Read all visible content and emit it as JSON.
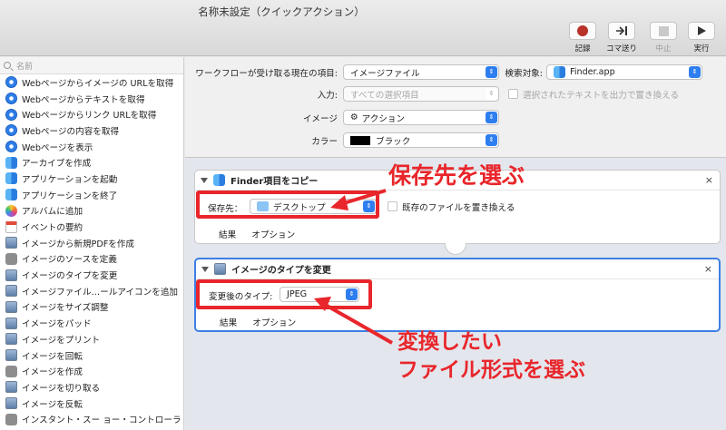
{
  "window": {
    "title": "名称未設定（クイックアクション）"
  },
  "toolbar": {
    "record": "記録",
    "step": "コマ送り",
    "stop": "中止",
    "run": "実行"
  },
  "sidebar": {
    "search_placeholder": "名前",
    "items": [
      {
        "label": "Webページからイメージの URLを取得",
        "icon": "safari-icon"
      },
      {
        "label": "Webページからテキストを取得",
        "icon": "safari-icon"
      },
      {
        "label": "Webページからリンク URLを取得",
        "icon": "safari-icon"
      },
      {
        "label": "Webページの内容を取得",
        "icon": "safari-icon"
      },
      {
        "label": "Webページを表示",
        "icon": "safari-icon"
      },
      {
        "label": "アーカイブを作成",
        "icon": "finder-icon"
      },
      {
        "label": "アプリケーションを起動",
        "icon": "finder-icon"
      },
      {
        "label": "アプリケーションを終了",
        "icon": "finder-icon"
      },
      {
        "label": "アルバムに追加",
        "icon": "photos-icon"
      },
      {
        "label": "イベントの要約",
        "icon": "calendar-icon"
      },
      {
        "label": "イメージから新規PDFを作成",
        "icon": "preview-icon"
      },
      {
        "label": "イメージのソースを定義",
        "icon": "automator-icon"
      },
      {
        "label": "イメージのタイプを変更",
        "icon": "preview-icon"
      },
      {
        "label": "イメージファイル…ールアイコンを追加",
        "icon": "preview-icon"
      },
      {
        "label": "イメージをサイズ調整",
        "icon": "preview-icon"
      },
      {
        "label": "イメージをパッド",
        "icon": "preview-icon"
      },
      {
        "label": "イメージをプリント",
        "icon": "preview-icon"
      },
      {
        "label": "イメージを回転",
        "icon": "preview-icon"
      },
      {
        "label": "イメージを作成",
        "icon": "automator-icon"
      },
      {
        "label": "イメージを切り取る",
        "icon": "preview-icon"
      },
      {
        "label": "イメージを反転",
        "icon": "preview-icon"
      },
      {
        "label": "インスタント・スー ョー・コントローラ",
        "icon": "automator-icon"
      }
    ]
  },
  "workflow": {
    "input_label": "ワークフローが受け取る現在の項目:",
    "input_value": "イメージファイル",
    "target_label": "検索対象:",
    "target_value": "Finder.app",
    "source_label": "入力:",
    "source_value": "すべての選択項目",
    "replace_label": "選択されたテキストを出力で置き換える",
    "image_label": "イメージ",
    "image_value": "アクション",
    "color_label": "カラー",
    "color_value": "ブラック",
    "color_hex": "#000000"
  },
  "action1": {
    "title": "Finder項目をコピー",
    "dest_label": "保存先：",
    "dest_value": "デスクトップ",
    "overwrite_label": "既存のファイルを置き換える",
    "tab_results": "結果",
    "tab_options": "オプション",
    "close": "×"
  },
  "action2": {
    "title": "イメージのタイプを変更",
    "type_label": "変更後のタイプ:",
    "type_value": "JPEG",
    "tab_results": "結果",
    "tab_options": "オプション",
    "close": "×"
  },
  "annotations": {
    "dest_note": "保存先を選ぶ",
    "type_note_line1": "変換したい",
    "type_note_line2": "ファイル形式を選ぶ",
    "color": "#e8262b"
  }
}
